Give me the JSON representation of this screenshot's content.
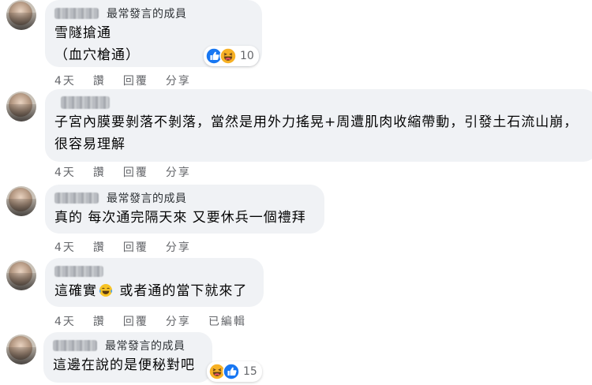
{
  "comments": [
    {
      "badge": "最常發言的成員",
      "lines": [
        "雪隧搶通",
        "（血穴槍通）"
      ],
      "reactions": {
        "count": "10",
        "icons": [
          "like-icon",
          "haha-icon"
        ]
      },
      "actions": [
        "4天",
        "讚",
        "回覆",
        "分享"
      ]
    },
    {
      "badge": "",
      "lines": [
        "子宮內膜要剝落不剝落，當然是用外力搖晃+周遭肌肉收縮帶動，引發土石流山崩，",
        "很容易理解"
      ],
      "actions": [
        "4天",
        "讚",
        "回覆",
        "分享"
      ]
    },
    {
      "badge": "最常發言的成員",
      "lines": [
        "真的 每次通完隔天來 又要休兵一個禮拜"
      ],
      "actions": [
        "4天",
        "讚",
        "回覆",
        "分享"
      ]
    },
    {
      "badge": "",
      "text_before_emoji": "這確實",
      "emoji": "laughing-tears-emoji",
      "text_after_emoji": " 或者通的當下就來了",
      "actions": [
        "4天",
        "讚",
        "回覆",
        "分享",
        "已編輯"
      ]
    },
    {
      "badge": "最常發言的成員",
      "lines": [
        "這邊在說的是便秘對吧"
      ],
      "reactions": {
        "count": "15",
        "icons": [
          "haha-icon",
          "like-icon"
        ]
      }
    }
  ],
  "colors": {
    "bubble_bg": "#f0f2f5",
    "like_blue": "#1877f2",
    "haha_yellow": "#f7b125",
    "meta_gray": "#65676b"
  }
}
